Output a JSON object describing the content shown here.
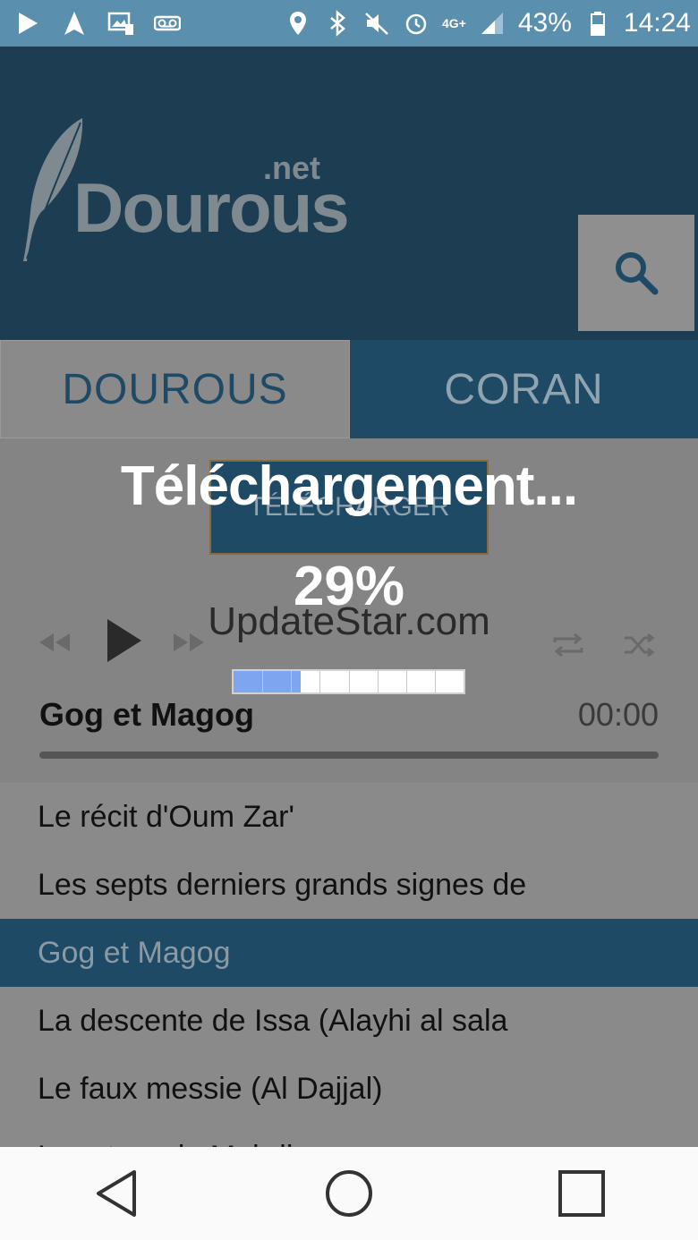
{
  "status_bar": {
    "battery": "43%",
    "time": "14:24",
    "network": "4G+"
  },
  "header": {
    "logo_main": "Dourous",
    "logo_suffix": ".net"
  },
  "tabs": [
    {
      "label": "DOUROUS",
      "active": false
    },
    {
      "label": "CORAN",
      "active": true
    }
  ],
  "player": {
    "download_button_label": "TÉLÉCHARGER",
    "watermark": "UpdateStar.com",
    "track_title": "Gog et Magog",
    "track_time": "00:00"
  },
  "list": [
    {
      "label": "Le récit d'Oum Zar'",
      "active": false
    },
    {
      "label": "Les septs derniers grands signes de",
      "active": false
    },
    {
      "label": "Gog et Magog",
      "active": true
    },
    {
      "label": "La descente de Issa (Alayhi al sala",
      "active": false
    },
    {
      "label": "Le faux messie (Al Dajjal)",
      "active": false
    },
    {
      "label": "Le retour du Mahdi",
      "active": false
    }
  ],
  "overlay": {
    "title": "Téléchargement...",
    "percent_label": "29%",
    "progress": 0.29
  },
  "colors": {
    "status_bar": "#5b8fae",
    "header": "#1c3d52",
    "accent": "#1f4a66",
    "progress_fill": "#7ea6f0"
  }
}
